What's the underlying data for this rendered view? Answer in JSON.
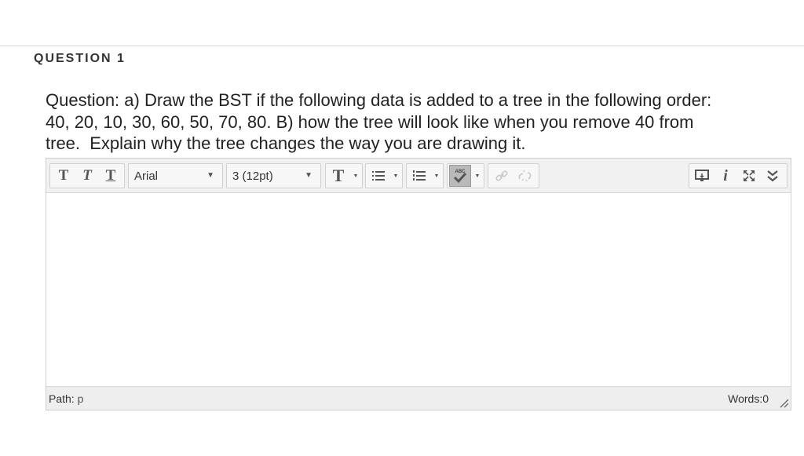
{
  "question": {
    "header": "QUESTION 1",
    "text": "Question: a) Draw the BST if the following data is added to a tree in the following order:\n40, 20, 10, 30, 60, 50, 70, 80. B) how the tree will look like when you remove 40 from\ntree.  Explain why the tree changes the way you are drawing it."
  },
  "toolbar": {
    "bold_label": "T",
    "italic_label": "T",
    "underline_label": "T",
    "font_family": "Arial",
    "font_size": "3 (12pt)",
    "text_color_label": "T",
    "spellcheck_label": "ABC"
  },
  "status": {
    "path_label": "Path:",
    "path_value": "p",
    "words": "Words:0"
  },
  "colors": {
    "toolbar_bg": "#f1f1f1",
    "status_bg": "#eeeeee",
    "border": "#cfcfcf"
  }
}
